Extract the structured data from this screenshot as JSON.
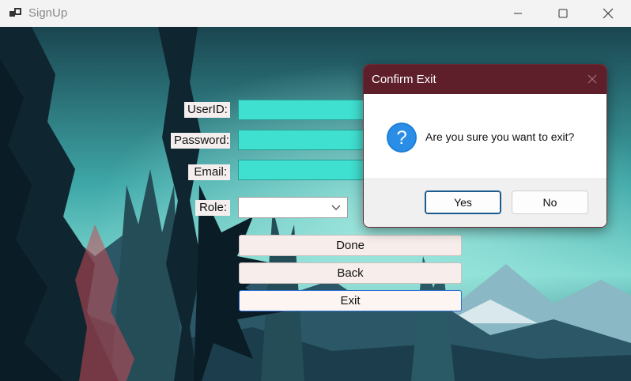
{
  "window": {
    "title": "SignUp",
    "app_icon": "app-window-icon",
    "controls": [
      "minimize-icon",
      "maximize-icon",
      "close-icon"
    ]
  },
  "form": {
    "userid_label": "UserID:",
    "userid_value": "",
    "password_label": "Password:",
    "password_value": "",
    "email_label": "Email:",
    "email_value": "",
    "role_label": "Role:",
    "role_value": "",
    "done_label": "Done",
    "back_label": "Back",
    "exit_label": "Exit"
  },
  "dialog": {
    "title": "Confirm Exit",
    "message": "Are you sure you want to exit?",
    "icon": "question-icon",
    "yes_label": "Yes",
    "no_label": "No"
  },
  "colors": {
    "field_bg": "#40e0d0",
    "dialog_title_bg": "#5e1f2a",
    "question_icon": "#1e7fd8",
    "focus_border": "#2d6ed3"
  }
}
